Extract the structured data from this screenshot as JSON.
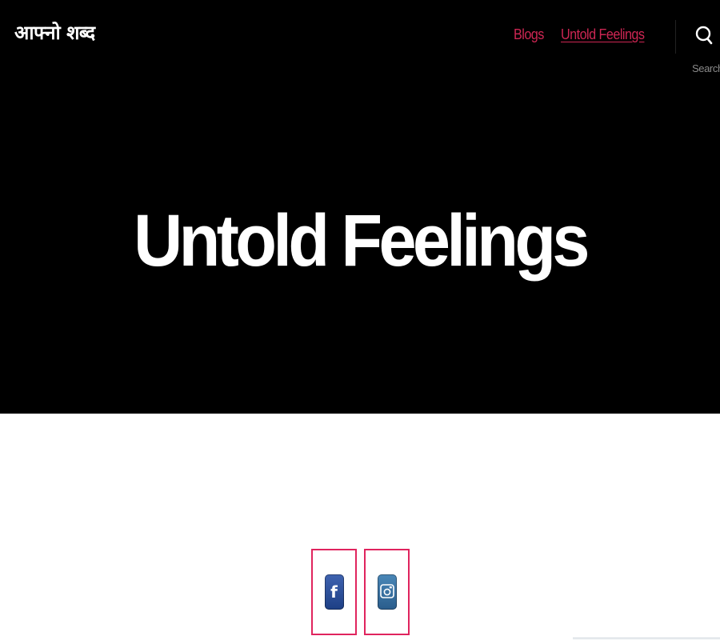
{
  "header": {
    "site_title": "आफ्नो शब्द",
    "nav": [
      {
        "label": "Blogs",
        "current": false
      },
      {
        "label": "Untold Feelings",
        "current": true
      }
    ],
    "search_label": "Search"
  },
  "hero": {
    "title": "Untold Feelings"
  },
  "social": {
    "items": [
      {
        "name": "facebook",
        "icon": "facebook-icon",
        "glyph": "f"
      },
      {
        "name": "instagram",
        "icon": "instagram-icon"
      }
    ],
    "border_color": "#e0245e"
  },
  "colors": {
    "header_bg": "#000000",
    "nav_link": "#cd2653",
    "hero_bg": "#000000",
    "hero_text": "#ffffff"
  }
}
